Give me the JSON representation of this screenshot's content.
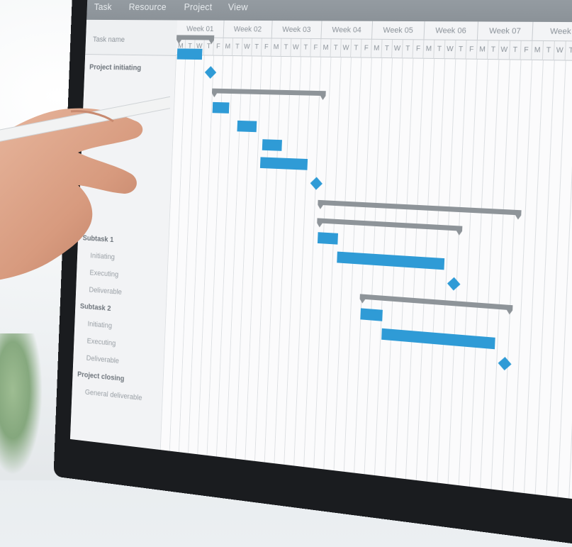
{
  "menu": {
    "items": [
      "Task",
      "Resource",
      "Project",
      "View"
    ]
  },
  "task_list": {
    "header": "Task name",
    "rows": [
      {
        "label": "Project initiating",
        "bold": true
      },
      {
        "label": "",
        "bold": false
      },
      {
        "label": "",
        "bold": false
      },
      {
        "label": "",
        "bold": false
      },
      {
        "label": "",
        "bold": false
      },
      {
        "label": "",
        "bold": false
      },
      {
        "label": "",
        "bold": false
      },
      {
        "label": "",
        "bold": false
      },
      {
        "label": "",
        "bold": false
      },
      {
        "label": "",
        "bold": false
      },
      {
        "label": "Subtask 1",
        "bold": true
      },
      {
        "label": "Initiating",
        "bold": false
      },
      {
        "label": "Executing",
        "bold": false
      },
      {
        "label": "Deliverable",
        "bold": false
      },
      {
        "label": "Subtask 2",
        "bold": true
      },
      {
        "label": "Initiating",
        "bold": false
      },
      {
        "label": "Executing",
        "bold": false
      },
      {
        "label": "Deliverable",
        "bold": false
      },
      {
        "label": "Project closing",
        "bold": true
      },
      {
        "label": "General deliverable",
        "bold": false
      }
    ]
  },
  "timeline": {
    "weeks": [
      "Week 01",
      "Week 02",
      "Week 03",
      "Week 04",
      "Week 05",
      "Week 06",
      "Week 07",
      "Week"
    ],
    "days": [
      "M",
      "T",
      "W",
      "T",
      "F"
    ]
  },
  "colors": {
    "task_bar": "#2f9bd6",
    "summary_bar": "#8e9499",
    "menu_bg": "#8b9298"
  }
}
